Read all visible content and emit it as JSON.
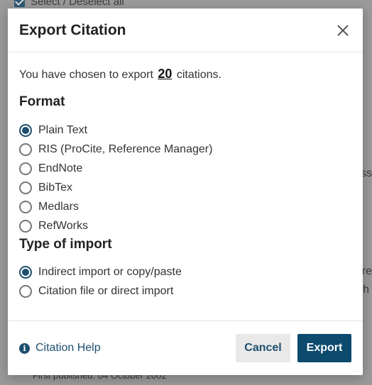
{
  "background": {
    "select_label": "Select / Deselect all",
    "fragment_right_1": "ss",
    "fragment_right_2": "ure",
    "fragment_right_3": "h",
    "footer_text": "First published: 04 October 2002"
  },
  "modal": {
    "title": "Export Citation",
    "close_icon": "close-icon",
    "intro_prefix": "You have chosen to export",
    "intro_count": "20",
    "intro_suffix": "citations.",
    "format_heading": "Format",
    "format_options": [
      {
        "label": "Plain Text",
        "checked": true
      },
      {
        "label": "RIS (ProCite, Reference Manager)",
        "checked": false
      },
      {
        "label": "EndNote",
        "checked": false
      },
      {
        "label": "BibTex",
        "checked": false
      },
      {
        "label": "Medlars",
        "checked": false
      },
      {
        "label": "RefWorks",
        "checked": false
      }
    ],
    "import_heading": "Type of import",
    "import_options": [
      {
        "label": "Indirect import or copy/paste",
        "checked": true
      },
      {
        "label": "Citation file or direct import",
        "checked": false
      }
    ],
    "help_label": "Citation Help",
    "help_icon": "info-icon",
    "cancel_label": "Cancel",
    "export_label": "Export"
  },
  "colors": {
    "accent": "#0c4a6e",
    "link": "#1d4f6e"
  }
}
